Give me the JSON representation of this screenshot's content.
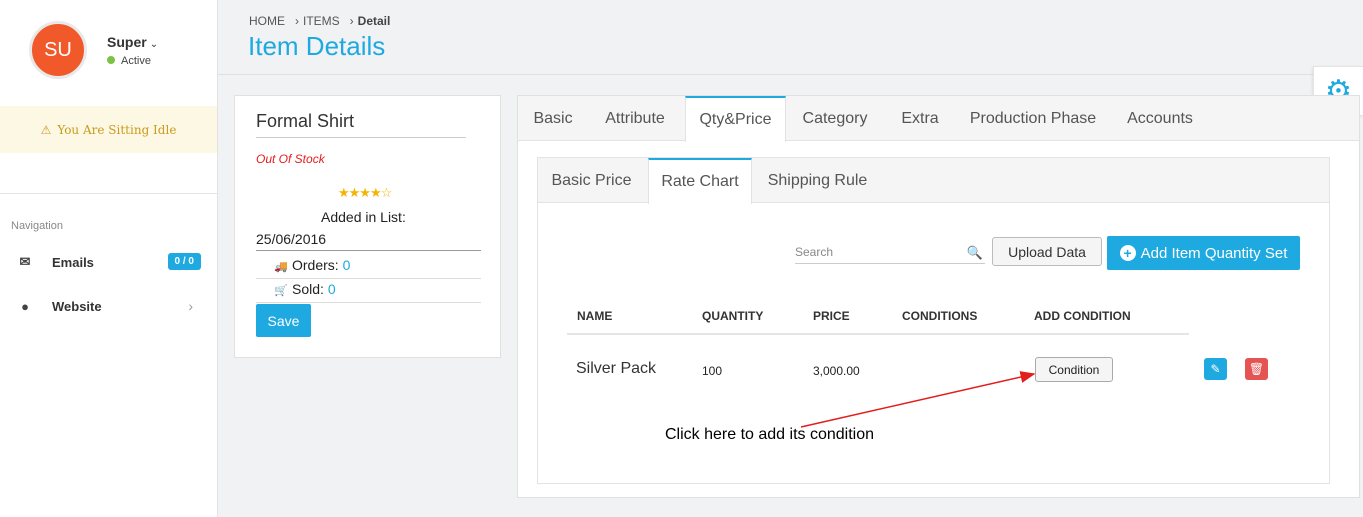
{
  "user": {
    "initials": "SU",
    "name": "Super",
    "status": "Active",
    "avatar_color": "#f1592a",
    "status_color": "#7cc246"
  },
  "idle_notice": "You Are Sitting Idle",
  "navigation": {
    "title": "Navigation",
    "items": [
      {
        "label": "Emails",
        "icon": "envelope-icon",
        "badge": "0 / 0"
      },
      {
        "label": "Website",
        "icon": "globe-icon"
      }
    ]
  },
  "breadcrumb": {
    "items": [
      "HOME",
      "ITEMS",
      "Detail"
    ]
  },
  "page_title": "Item Details",
  "product": {
    "title": "Formal Shirt",
    "stock_status": "Out Of Stock",
    "rating": 4,
    "rating_max": 5,
    "stars": "★★★★☆",
    "added_label": "Added in List:",
    "added_date": "25/06/2016",
    "orders_label": "Orders:",
    "orders_value": "0",
    "sold_label": "Sold:",
    "sold_value": "0",
    "save_label": "Save"
  },
  "tabs": [
    "Basic",
    "Attribute",
    "Qty&Price",
    "Category",
    "Extra",
    "Production Phase",
    "Accounts"
  ],
  "active_tab": "Qty&Price",
  "subtabs": [
    "Basic Price",
    "Rate Chart",
    "Shipping Rule"
  ],
  "active_subtab": "Rate Chart",
  "toolbar": {
    "search_placeholder": "Search",
    "upload_label": "Upload Data",
    "add_label": "Add Item Quantity Set"
  },
  "table": {
    "headers": [
      "NAME",
      "QUANTITY",
      "PRICE",
      "CONDITIONS",
      "ADD CONDITION"
    ],
    "rows": [
      {
        "name": "Silver Pack",
        "quantity": "100",
        "price": "3,000.00",
        "conditions": "",
        "action_label": "Condition"
      }
    ]
  },
  "annotation": "Click here to add its condition",
  "colors": {
    "accent": "#1ea9e1",
    "danger": "#e55353",
    "warning_text": "#c99b1e",
    "warning_bg": "#fcf8e3",
    "out_of_stock": "#e31c1c",
    "annotation_arrow": "#e31c1c"
  }
}
